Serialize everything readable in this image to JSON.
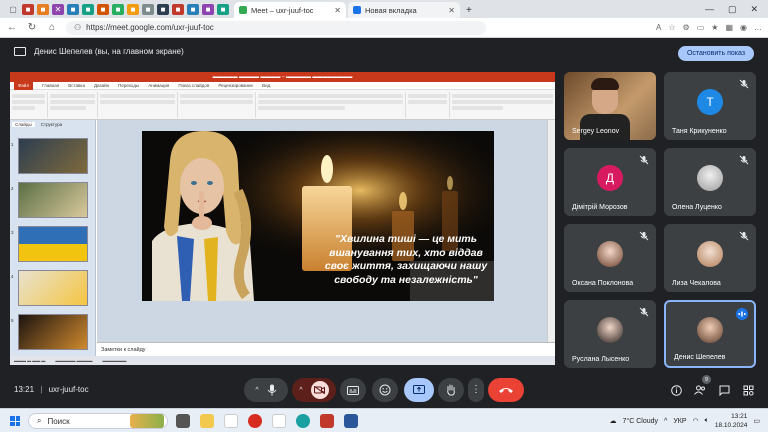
{
  "browser": {
    "tabs": [
      {
        "title": "Meet – uxr-juuf-toc",
        "active": true,
        "color": "#34a853"
      },
      {
        "title": "Новая вкладка",
        "active": false,
        "color": "#1a73e8"
      }
    ],
    "url": "https://meet.google.com/uxr-juuf-toc"
  },
  "meet": {
    "presenter_text": "Денис Шепелев (вы, на главном экране)",
    "stop_button": "Остановить показ",
    "time": "13:21",
    "meeting_code": "uxr-juuf-toc",
    "people_count": "9",
    "accent": "#a8c7fa",
    "end_call_color": "#ea4335"
  },
  "presentation": {
    "slide_text": "\"Хвилина тиші — це мить вшанування тих, хто віддав своє життя, захищаючи нашу свободу та незалежність\"",
    "notes_placeholder": "Заметки к слайду",
    "pane_tabs": [
      "Слайды",
      "Структура"
    ],
    "slide_numbers": [
      "1",
      "2",
      "3",
      "4",
      "5"
    ],
    "menu": [
      "Файл",
      "Главная",
      "Вставка",
      "Дизайн",
      "Переходы",
      "Анимация",
      "Показ слайдов",
      "Рецензирование",
      "Вид"
    ]
  },
  "participants": [
    {
      "name": "Sergey Leonov",
      "type": "video",
      "muted": false
    },
    {
      "name": "Таня Крикуненко",
      "type": "letter",
      "letter": "Т",
      "color": "#1e88e5",
      "muted": true
    },
    {
      "name": "Дімітрій Морозов",
      "type": "letter",
      "letter": "Д",
      "color": "#d81b60",
      "muted": true
    },
    {
      "name": "Олена Луценко",
      "type": "photo",
      "muted": true
    },
    {
      "name": "Оксана Поклонова",
      "type": "photo",
      "muted": true
    },
    {
      "name": "Лиза Чекалова",
      "type": "photo",
      "muted": true
    },
    {
      "name": "Руслана Лысенко",
      "type": "photo",
      "muted": true
    },
    {
      "name": "Денис Шепелев",
      "type": "photo",
      "muted": false,
      "speaking": true
    }
  ],
  "taskbar": {
    "search": "Поиск",
    "weather": "7°C  Cloudy",
    "lang": "УКР",
    "time": "13:21",
    "date": "18.10.2024"
  }
}
